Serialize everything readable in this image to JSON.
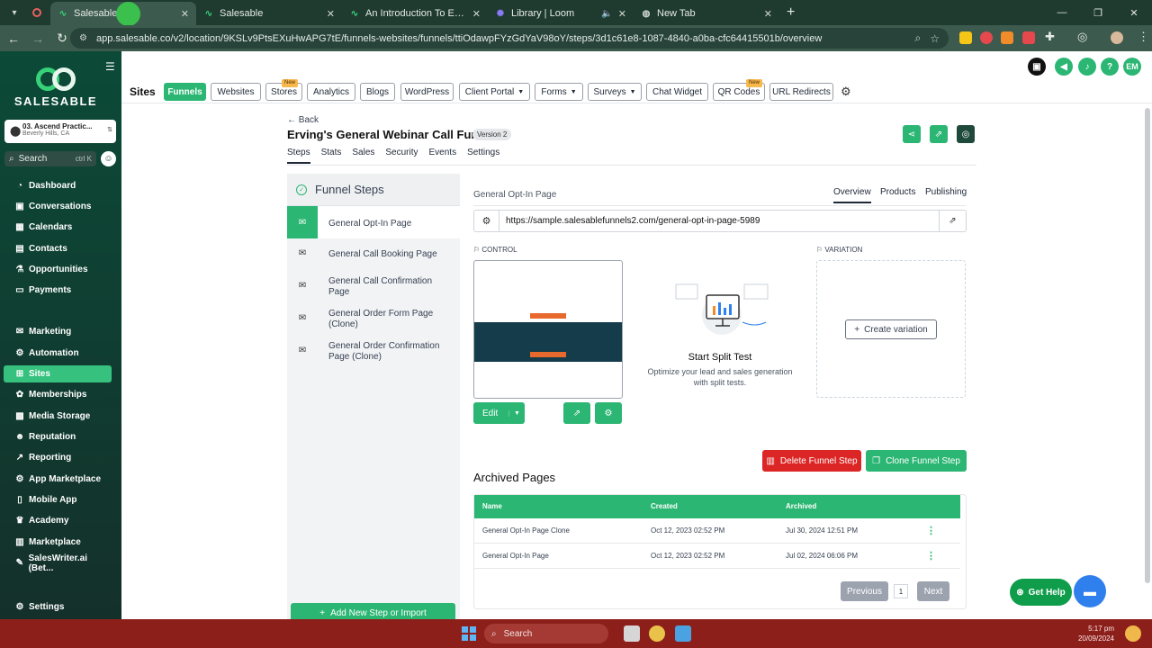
{
  "browser": {
    "tabs": [
      {
        "title": "Salesable",
        "icon": "salesable-icon",
        "active": true
      },
      {
        "title": "Salesable",
        "icon": "salesable-icon",
        "active": false
      },
      {
        "title": "An Introduction To Email Delive",
        "icon": "salesable-icon",
        "active": false
      },
      {
        "title": "Library | Loom",
        "icon": "loom-icon",
        "active": false
      },
      {
        "title": "New Tab",
        "icon": "globe-icon",
        "active": false
      }
    ],
    "url": "app.salesable.co/v2/location/9KSLv9PtsEXuHwAPG7tE/funnels-websites/funnels/ttiOdawpFYzGdYaV98oY/steps/3d1c61e8-1087-4840-a0ba-cfc64415501b/overview"
  },
  "sidebar": {
    "logo": "SALESABLE",
    "location": {
      "name": "03. Ascend Practic...",
      "city": "Beverly Hills, CA"
    },
    "search": {
      "label": "Search",
      "shortcut": "ctrl K"
    },
    "items": [
      {
        "label": "Dashboard",
        "icon": "dashboard-icon"
      },
      {
        "label": "Conversations",
        "icon": "chat-icon"
      },
      {
        "label": "Calendars",
        "icon": "calendar-icon"
      },
      {
        "label": "Contacts",
        "icon": "contacts-icon"
      },
      {
        "label": "Opportunities",
        "icon": "opportunities-icon"
      },
      {
        "label": "Payments",
        "icon": "payments-icon"
      },
      {
        "label": "Marketing",
        "icon": "marketing-icon"
      },
      {
        "label": "Automation",
        "icon": "automation-icon"
      },
      {
        "label": "Sites",
        "icon": "sites-icon",
        "active": true
      },
      {
        "label": "Memberships",
        "icon": "memberships-icon"
      },
      {
        "label": "Media Storage",
        "icon": "media-icon"
      },
      {
        "label": "Reputation",
        "icon": "reputation-icon"
      },
      {
        "label": "Reporting",
        "icon": "reporting-icon"
      },
      {
        "label": "App Marketplace",
        "icon": "marketplace-icon"
      },
      {
        "label": "Mobile App",
        "icon": "mobile-icon"
      },
      {
        "label": "Academy",
        "icon": "academy-icon"
      },
      {
        "label": "Marketplace",
        "icon": "store-icon"
      },
      {
        "label": "SalesWriter.ai (Bet...",
        "icon": "pen-icon"
      },
      {
        "label": "Settings",
        "icon": "gear-icon"
      }
    ]
  },
  "header": {
    "avatar_initials": "EM",
    "help": "?"
  },
  "sites": {
    "title": "Sites",
    "tabs": [
      {
        "label": "Funnels",
        "active": true
      },
      {
        "label": "Websites"
      },
      {
        "label": "Stores",
        "badge": "New"
      },
      {
        "label": "Analytics"
      },
      {
        "label": "Blogs"
      },
      {
        "label": "WordPress"
      },
      {
        "label": "Client Portal",
        "dropdown": true
      },
      {
        "label": "Forms",
        "dropdown": true
      },
      {
        "label": "Surveys",
        "dropdown": true
      },
      {
        "label": "Chat Widget"
      },
      {
        "label": "QR Codes",
        "badge": "New"
      },
      {
        "label": "URL Redirects"
      }
    ]
  },
  "funnel": {
    "back": "Back",
    "title": "Erving's General Webinar Call Funnel",
    "version": "Version 2",
    "tabs": [
      "Steps",
      "Stats",
      "Sales",
      "Security",
      "Events",
      "Settings"
    ],
    "steps_title": "Funnel Steps",
    "steps": [
      "General Opt-In Page",
      "General Call Booking Page",
      "General Call Confirmation Page",
      "General Order Form Page (Clone)",
      "General Order Confirmation Page (Clone)"
    ],
    "add_step": "Add New Step or Import"
  },
  "page": {
    "name": "General Opt-In Page",
    "tabs": [
      "Overview",
      "Products",
      "Publishing"
    ],
    "url": "https://sample.salesablefunnels2.com/general-opt-in-page-5989",
    "control_label": "CONTROL",
    "variation_label": "VARIATION",
    "edit": "Edit",
    "create_variation": "Create variation",
    "split_title": "Start Split Test",
    "split_sub": "Optimize your lead and sales generation with split tests.",
    "delete": "Delete Funnel Step",
    "clone": "Clone Funnel Step"
  },
  "archived": {
    "title": "Archived Pages",
    "columns": [
      "Name",
      "Created",
      "Archived"
    ],
    "rows": [
      [
        "General Opt-In Page Clone",
        "Oct 12, 2023 02:52 PM",
        "Jul 30, 2024 12:51 PM"
      ],
      [
        "General Opt-In Page",
        "Oct 12, 2023 02:52 PM",
        "Jul 02, 2024 06:06 PM"
      ]
    ],
    "prev": "Previous",
    "page": "1",
    "next": "Next"
  },
  "help": {
    "label": "Get Help"
  },
  "taskbar": {
    "search": "Search",
    "time": "5:17 pm",
    "date": "20/09/2024"
  },
  "colors": {
    "brand": "#2bb673",
    "danger": "#dc2626",
    "sidebar": "#0c4a37"
  }
}
